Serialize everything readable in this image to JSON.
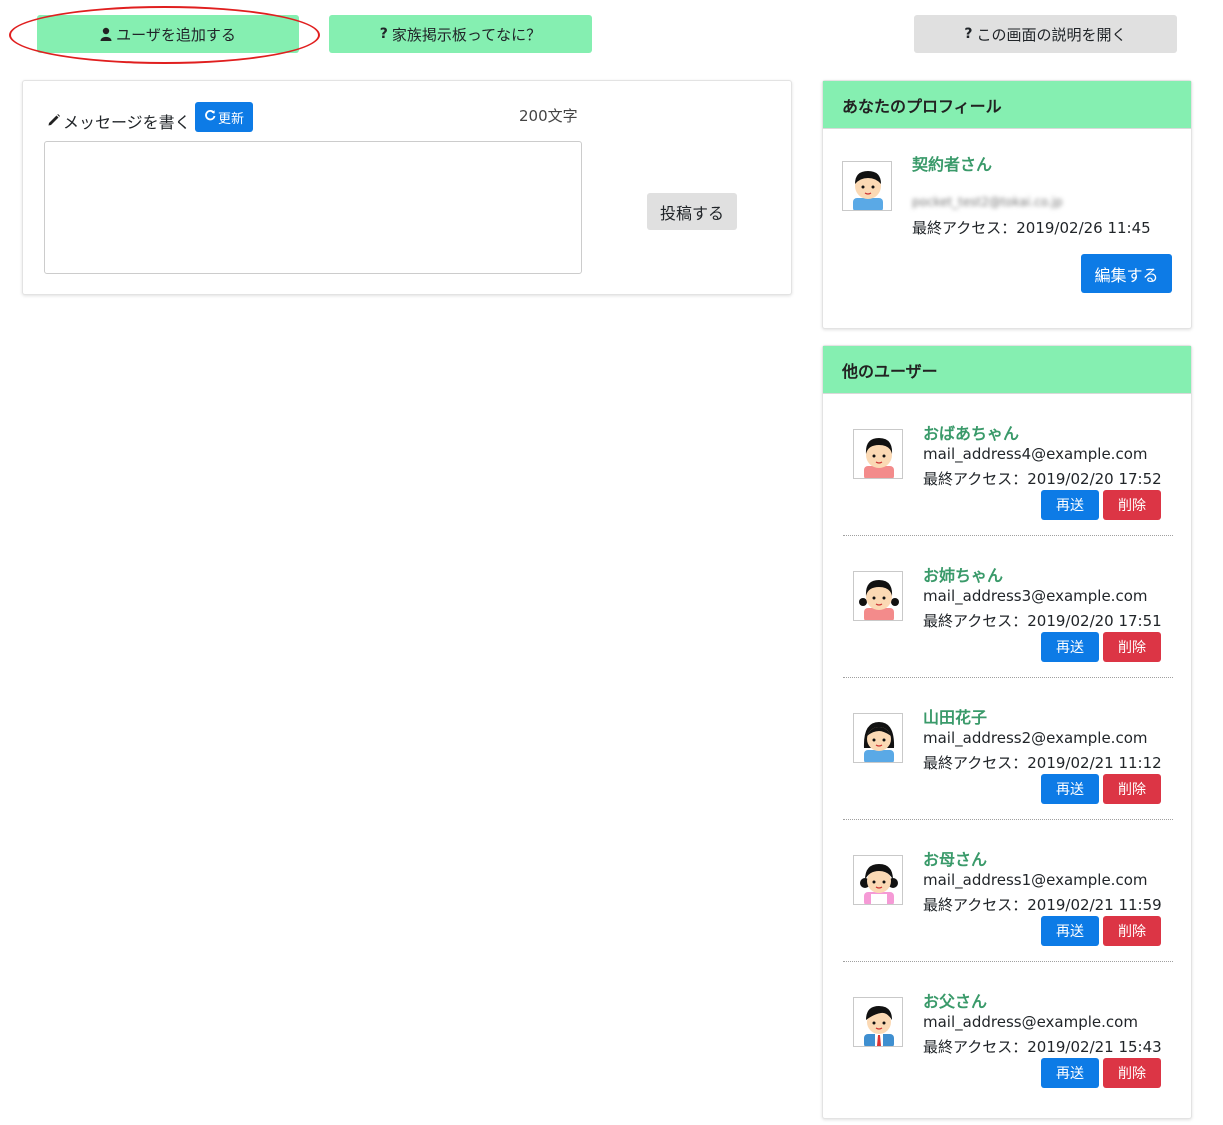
{
  "top_buttons": {
    "add_user": "ユーザを追加する",
    "about": "家族掲示板ってなに？",
    "help": "この画面の説明を開く"
  },
  "compose": {
    "label": "メッセージを書く",
    "refresh": "更新",
    "char_limit": "200文字",
    "message_value": "",
    "post": "投稿する"
  },
  "profile": {
    "header": "あなたのプロフィール",
    "name": "契約者さん",
    "email_blurred": "pocket_test2@tokai.co.jp",
    "last_access": "最終アクセス：2019/02/26 11:45",
    "edit": "編集する"
  },
  "others": {
    "header": "他のユーザー",
    "resend_label": "再送",
    "delete_label": "削除",
    "users": [
      {
        "name": "おばあちゃん",
        "email": "mail_address4@example.com",
        "last_access": "最終アクセス：2019/02/20 17:52",
        "avatar": "grandma-avatar"
      },
      {
        "name": "お姉ちゃん",
        "email": "mail_address3@example.com",
        "last_access": "最終アクセス：2019/02/20 17:51",
        "avatar": "sister-avatar"
      },
      {
        "name": "山田花子",
        "email": "mail_address2@example.com",
        "last_access": "最終アクセス：2019/02/21 11:12",
        "avatar": "woman-avatar"
      },
      {
        "name": "お母さん",
        "email": "mail_address1@example.com",
        "last_access": "最終アクセス：2019/02/21 11:59",
        "avatar": "mother-avatar"
      },
      {
        "name": "お父さん",
        "email": "mail_address@example.com",
        "last_access": "最終アクセス：2019/02/21 15:43",
        "avatar": "father-avatar"
      }
    ]
  },
  "colors": {
    "green": "#85efb1",
    "blue": "#0d7be6",
    "red": "#dc3545",
    "name_green": "#3a9a6a",
    "annotation": "#e01f1f"
  }
}
